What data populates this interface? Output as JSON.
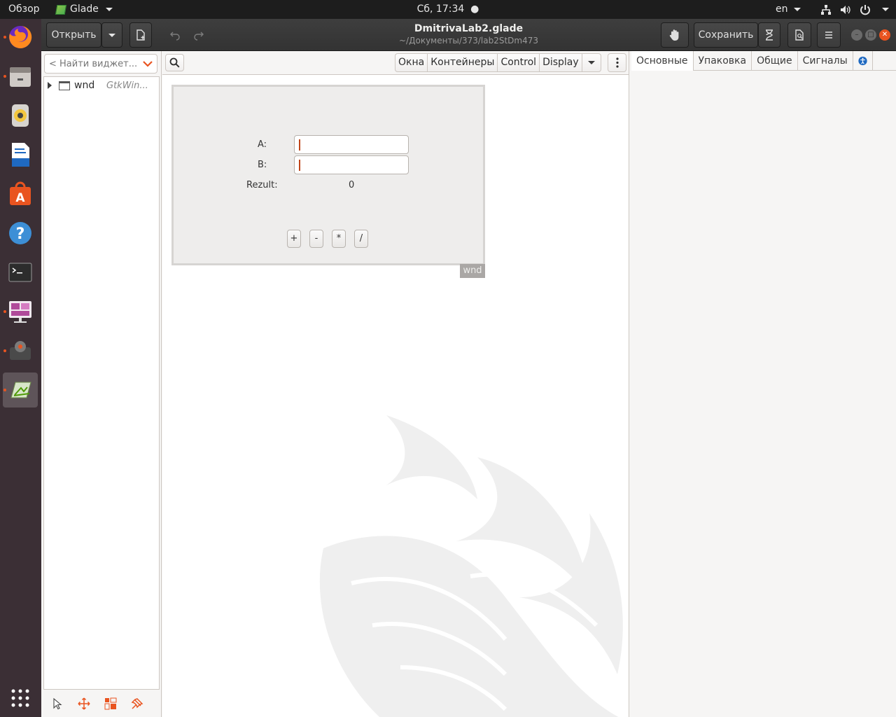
{
  "topbar": {
    "overview": "Обзор",
    "app_name": "Glade",
    "clock": "Сб, 17:34",
    "lang": "en",
    "icons": [
      "network-icon",
      "volume-icon",
      "power-icon"
    ]
  },
  "dock": {
    "items": [
      "firefox",
      "files",
      "rhythmbox",
      "libreoffice-writer",
      "ubuntu-software",
      "help",
      "terminal",
      "remote-desktop",
      "settings-tools",
      "glade"
    ],
    "accent": "#e95420"
  },
  "header": {
    "open_label": "Открыть",
    "title": "DmitrivaLab2.glade",
    "subtitle": "~/Документы/373/lab2StDm473",
    "save_label": "Сохранить"
  },
  "left": {
    "search_placeholder": "< Найти виджет...",
    "tree": [
      {
        "name": "wnd",
        "type": "GtkWin..."
      }
    ]
  },
  "palette": {
    "groups": [
      "Окна",
      "Контейнеры",
      "Control",
      "Display"
    ]
  },
  "design": {
    "label_a": "A:",
    "label_b": "B:",
    "label_result": "Rezult:",
    "result_value": "0",
    "value_a": "",
    "value_b": "",
    "buttons": [
      "+",
      "-",
      "*",
      "/"
    ],
    "window_tag": "wnd"
  },
  "right": {
    "tabs": [
      "Основные",
      "Упаковка",
      "Общие",
      "Сигналы"
    ]
  }
}
